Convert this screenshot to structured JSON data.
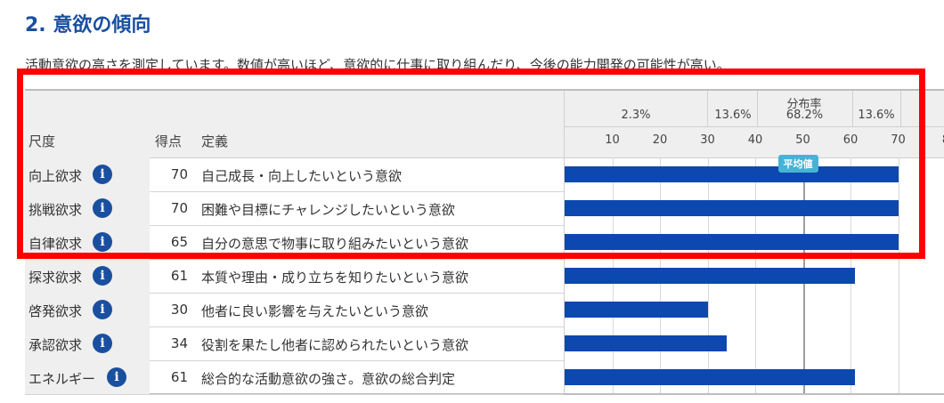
{
  "section": {
    "title": "2. 意欲の傾向",
    "description": "活動意欲の高さを測定しています。数値が高いほど、意欲的に仕事に取り組んだり、今後の能力開発の可能性が高い。"
  },
  "table": {
    "headers": {
      "scale": "尺度",
      "score": "得点",
      "definition": "定義"
    },
    "rows": [
      {
        "name": "向上欲求",
        "score": "70",
        "definition": "自己成長・向上したいという意欲",
        "value": 70
      },
      {
        "name": "挑戦欲求",
        "score": "70",
        "definition": "困難や目標にチャレンジしたいという意欲",
        "value": 70
      },
      {
        "name": "自律欲求",
        "score": "65",
        "definition": "自分の意思で物事に取り組みたいという意欲",
        "value": 70
      },
      {
        "name": "探求欲求",
        "score": "61",
        "definition": "本質や理由・成り立ちを知りたいという意欲",
        "value": 61
      },
      {
        "name": "啓発欲求",
        "score": "30",
        "definition": "他者に良い影響を与えたいという意欲",
        "value": 30
      },
      {
        "name": "承認欲求",
        "score": "34",
        "definition": "役割を果たし他者に認められたいという意欲",
        "value": 34
      },
      {
        "name": "エネルギー",
        "score": "61",
        "definition": "総合的な活動意欲の強さ。意欲の総合判定",
        "value": 61
      }
    ],
    "info_icon_glyph": "i"
  },
  "distribution": {
    "title": "分布率",
    "bands": [
      "2.3%",
      "13.6%",
      "68.2%",
      "13.6%"
    ],
    "ticks": [
      "10",
      "20",
      "30",
      "40",
      "50",
      "60",
      "70",
      "8"
    ],
    "average_label": "平均値",
    "average_value": 50
  },
  "colors": {
    "bar": "#0d47b0",
    "title": "#1a4fa0",
    "highlight": "#ff0000",
    "badge": "#46b3d6"
  }
}
